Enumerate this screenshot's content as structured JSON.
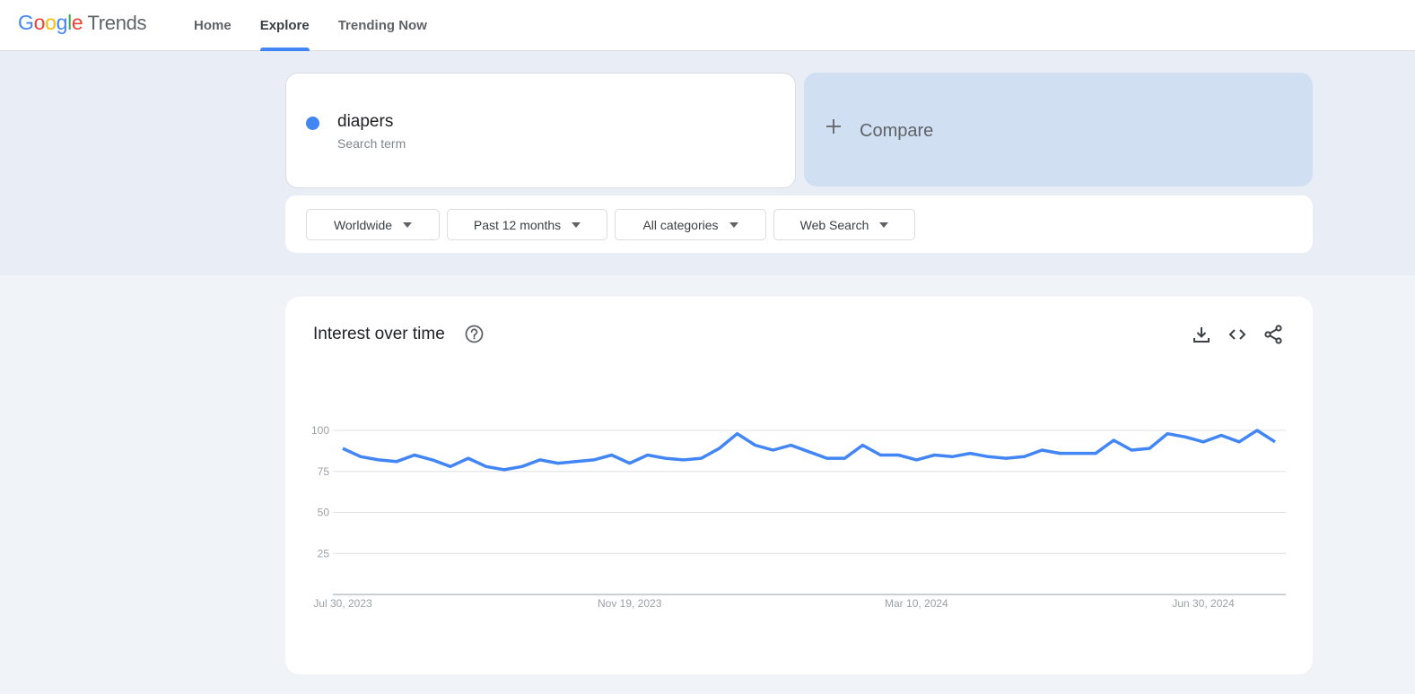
{
  "app": {
    "logo": {
      "google": "Google",
      "product": "Trends"
    },
    "nav": [
      {
        "label": "Home",
        "active": false
      },
      {
        "label": "Explore",
        "active": true
      },
      {
        "label": "Trending Now",
        "active": false
      }
    ]
  },
  "search": {
    "term": {
      "name": "diapers",
      "type": "Search term",
      "color": "#4285f4"
    },
    "compare": {
      "icon": "plus-icon",
      "label": "Compare"
    }
  },
  "filters": [
    {
      "label": "Worldwide"
    },
    {
      "label": "Past 12 months"
    },
    {
      "label": "All categories"
    },
    {
      "label": "Web Search"
    }
  ],
  "interest_card": {
    "title": "Interest over time",
    "icons": [
      "help-icon",
      "download-icon",
      "embed-code-icon",
      "share-icon"
    ]
  },
  "chart_data": {
    "type": "line",
    "title": "Interest over time",
    "xlabel": "",
    "ylabel": "",
    "ylim": [
      0,
      100
    ],
    "yticks": [
      25,
      50,
      75,
      100
    ],
    "xtick_labels": [
      "Jul 30, 2023",
      "Nov 19, 2023",
      "Mar 10, 2024",
      "Jun 30, 2024"
    ],
    "xtick_indices": [
      0,
      16,
      32,
      48
    ],
    "grid": true,
    "series": [
      {
        "name": "diapers",
        "color": "#4285f4",
        "values": [
          89,
          84,
          82,
          81,
          85,
          82,
          78,
          83,
          78,
          76,
          78,
          82,
          80,
          81,
          82,
          85,
          80,
          85,
          83,
          82,
          83,
          89,
          98,
          91,
          88,
          91,
          87,
          83,
          83,
          91,
          85,
          85,
          82,
          85,
          84,
          86,
          84,
          83,
          84,
          88,
          86,
          86,
          86,
          94,
          88,
          89,
          98,
          96,
          93,
          97,
          93,
          100,
          93
        ]
      }
    ]
  }
}
